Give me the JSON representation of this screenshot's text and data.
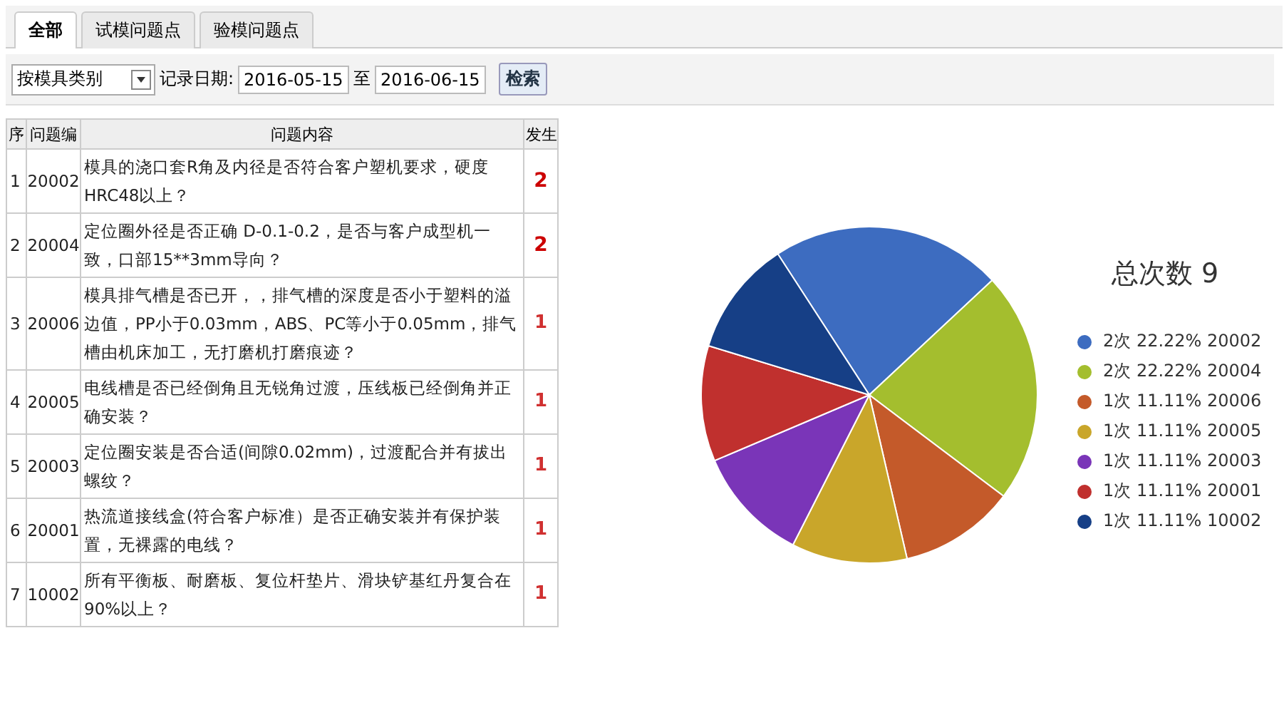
{
  "tabs": [
    {
      "label": "全部",
      "selected": true
    },
    {
      "label": "试模问题点",
      "selected": false
    },
    {
      "label": "验模问题点",
      "selected": false
    }
  ],
  "toolbar": {
    "category_select": "按模具类别",
    "date_label": "记录日期:",
    "date_from": "2016-05-15",
    "separator": "至",
    "date_to": "2016-06-15",
    "search_button": "检索"
  },
  "table": {
    "columns": [
      "序",
      "问题编",
      "问题内容",
      "发生"
    ],
    "rows": [
      {
        "index": "1",
        "code": "20002",
        "content": "模具的浇口套R角及内径是否符合客户塑机要求，硬度HRC48以上？",
        "count": "2",
        "highlight": true
      },
      {
        "index": "2",
        "code": "20004",
        "content": "定位圈外径是否正确 D-0.1-0.2，是否与客户成型机一致，口部15**3mm导向？",
        "count": "2",
        "highlight": true
      },
      {
        "index": "3",
        "code": "20006",
        "content": "模具排气槽是否已开，，排气槽的深度是否小于塑料的溢边值，PP小于0.03mm，ABS、PC等小于0.05mm，排气槽由机床加工，无打磨机打磨痕迹？",
        "count": "1",
        "highlight": false
      },
      {
        "index": "4",
        "code": "20005",
        "content": "电线槽是否已经倒角且无锐角过渡，压线板已经倒角并正确安装？",
        "count": "1",
        "highlight": false
      },
      {
        "index": "5",
        "code": "20003",
        "content": "定位圈安装是否合适(间隙0.02mm)，过渡配合并有拔出螺纹？",
        "count": "1",
        "highlight": false
      },
      {
        "index": "6",
        "code": "20001",
        "content": "热流道接线盒(符合客户标准）是否正确安装并有保护装置，无裸露的电线？",
        "count": "1",
        "highlight": false
      },
      {
        "index": "7",
        "code": "10002",
        "content": "所有平衡板、耐磨板、复位杆垫片、滑块铲基红丹复合在90%以上？",
        "count": "1",
        "highlight": false
      }
    ]
  },
  "chart_data": {
    "type": "pie",
    "title": "总次数 9",
    "categories": [
      "2次 22.22% 20002",
      "2次 22.22% 20004",
      "1次 11.11% 20006",
      "1次 11.11% 20005",
      "1次 11.11% 20003",
      "1次 11.11% 20001",
      "1次 11.11% 10002"
    ],
    "values": [
      2,
      2,
      1,
      1,
      1,
      1,
      1
    ],
    "legend": "right",
    "colors": [
      "#3d6cc0",
      "#a4be2e",
      "#c45a2a",
      "#c9a62a",
      "#7a35b8",
      "#c0302e",
      "#163f86"
    ]
  }
}
